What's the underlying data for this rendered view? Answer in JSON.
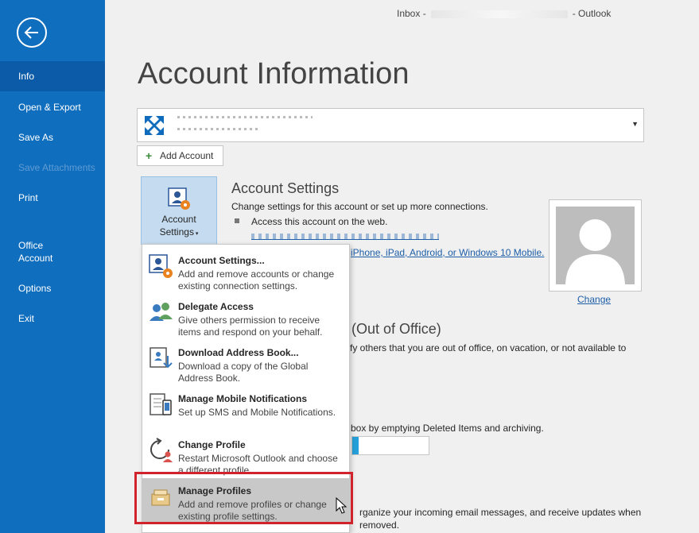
{
  "window": {
    "title_prefix": "Inbox -",
    "title_suffix": "- Outlook"
  },
  "sidebar": {
    "items": [
      {
        "label": "Info",
        "active": true
      },
      {
        "label": "Open & Export"
      },
      {
        "label": "Save As"
      },
      {
        "label": "Save Attachments",
        "disabled": true
      },
      {
        "label": "Print"
      },
      {
        "label": "Office\nAccount"
      },
      {
        "label": "Options"
      },
      {
        "label": "Exit"
      }
    ]
  },
  "page": {
    "title": "Account Information"
  },
  "add_account": {
    "label": "Add Account"
  },
  "account_settings": {
    "button_label_1": "Account",
    "button_label_2": "Settings",
    "heading": "Account Settings",
    "description": "Change settings for this account or set up more connections.",
    "bullet_1": "Access this account on the web.",
    "bullet_2_link_tail": "iPhone, iPad, Android, or Windows 10 Mobile."
  },
  "profile": {
    "change_link": "Change"
  },
  "out_of_office": {
    "heading_tail": "(Out of Office)",
    "text_tail": "fy others that you are out of office, on vacation, or not available to"
  },
  "mailbox": {
    "text_tail": "box by emptying Deleted Items and archiving.",
    "usage_fraction": 0.08
  },
  "rules": {
    "text_tail_1": "rganize your incoming email messages, and receive updates when",
    "text_tail_2": "removed."
  },
  "menu": {
    "items": [
      {
        "title": "Account Settings...",
        "desc": "Add and remove accounts or change existing connection settings."
      },
      {
        "title": "Delegate Access",
        "desc": "Give others permission to receive items and respond on your behalf."
      },
      {
        "title": "Download Address Book...",
        "desc": "Download a copy of the Global Address Book."
      },
      {
        "title": "Manage Mobile Notifications",
        "desc": "Set up SMS and Mobile Notifications."
      },
      {
        "title": "Change Profile",
        "desc": "Restart Microsoft Outlook and choose a different profile."
      },
      {
        "title": "Manage Profiles",
        "desc": "Add and remove profiles or change existing profile settings."
      }
    ]
  },
  "colors": {
    "sidebar": "#106ebe",
    "accent_red": "#d0232b",
    "link": "#1c5ea8"
  }
}
